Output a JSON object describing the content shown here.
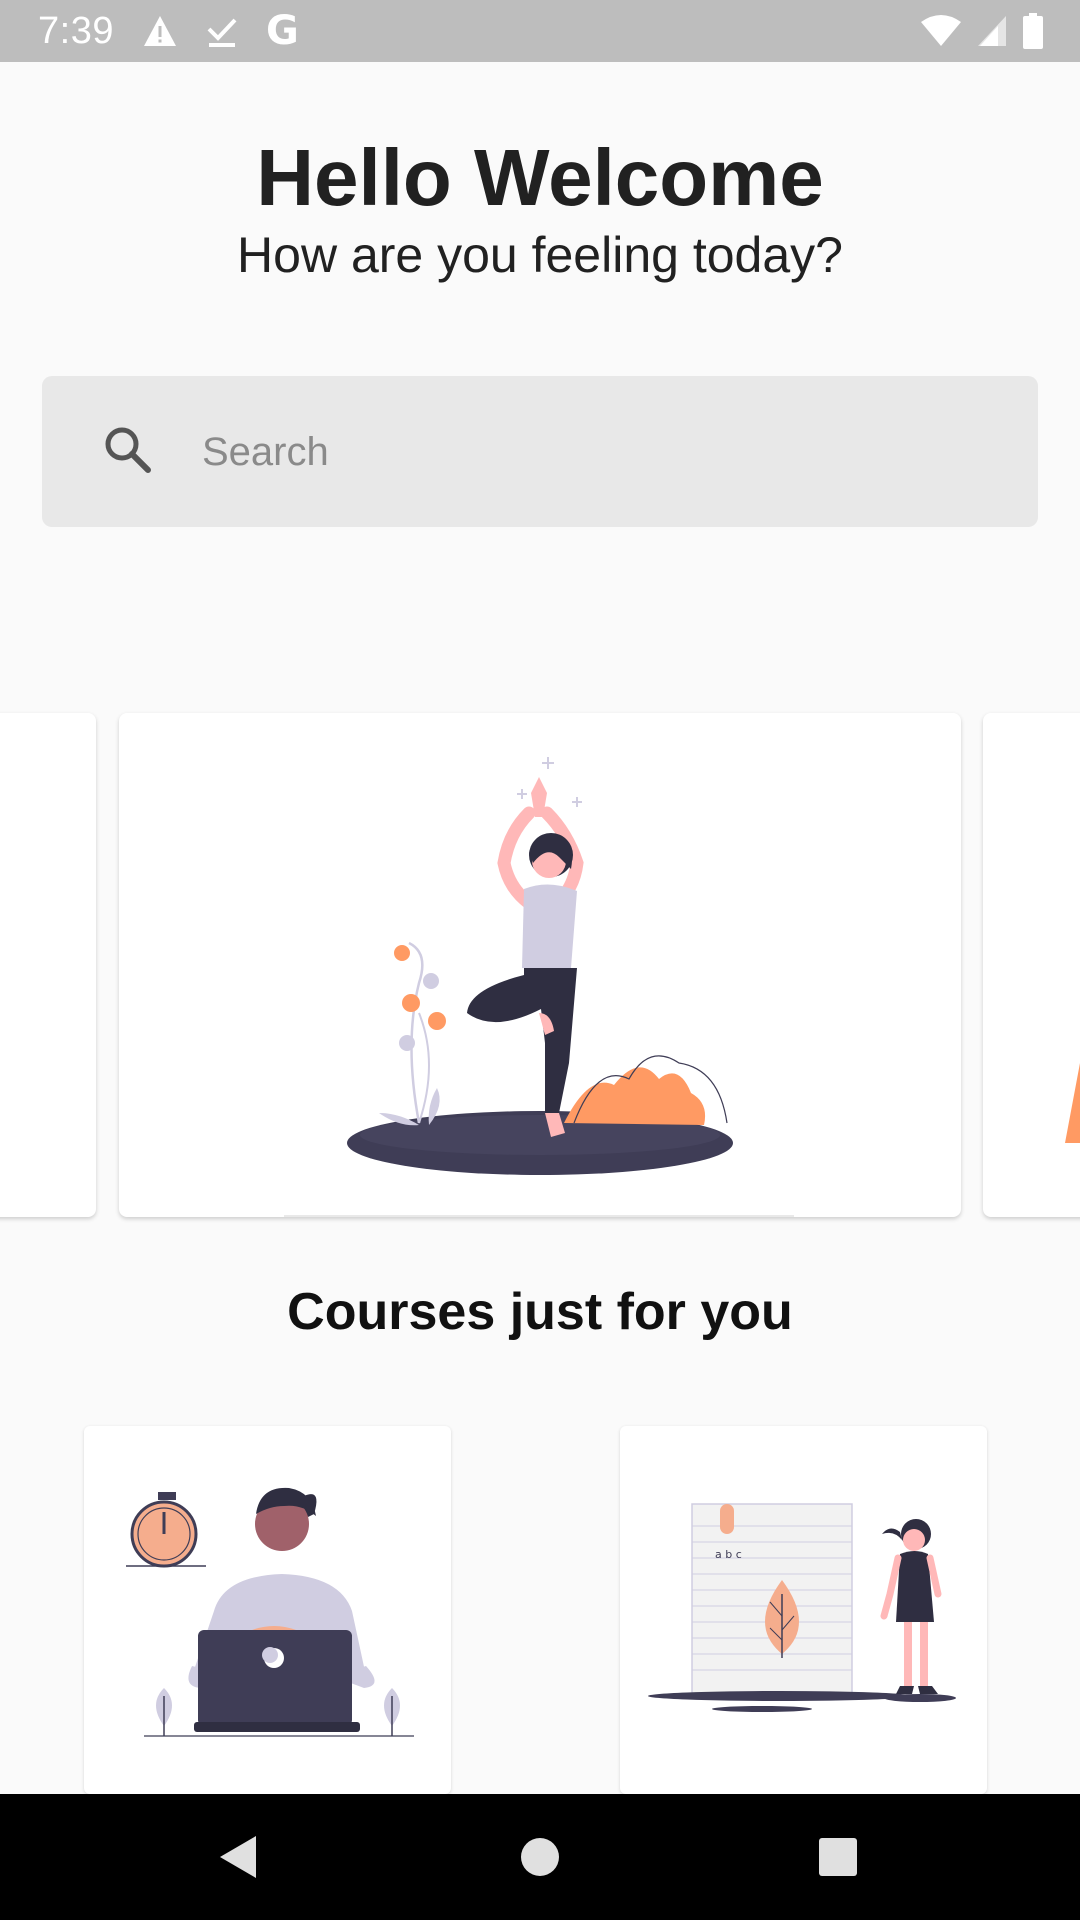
{
  "status_bar": {
    "time": "7:39",
    "google_letter": "G",
    "icons": [
      "warning-icon",
      "download-done-icon",
      "google-icon",
      "wifi-icon",
      "cell-signal-icon",
      "battery-icon"
    ]
  },
  "header": {
    "title": "Hello Welcome",
    "subtitle": "How are you feeling today?"
  },
  "search": {
    "placeholder": "Search",
    "value": ""
  },
  "carousel": {
    "cards": [
      {
        "illustration": "partial-card-left"
      },
      {
        "illustration": "yoga-tree-pose-illustration"
      },
      {
        "illustration": "partial-card-right"
      }
    ]
  },
  "courses": {
    "title": "Courses just for you",
    "cards": [
      {
        "illustration": "person-laptop-stopwatch-illustration"
      },
      {
        "illustration": "woman-notebook-leaf-illustration",
        "note_text": "a b c"
      }
    ]
  },
  "nav": {
    "icons": [
      "back-icon",
      "home-icon",
      "recents-icon"
    ]
  },
  "colors": {
    "accent": "#ff9a63",
    "dark": "#3f3d56",
    "lavender": "#d0cde1",
    "skin": "#ffb8b8",
    "status_bar": "#bdbdbd"
  }
}
